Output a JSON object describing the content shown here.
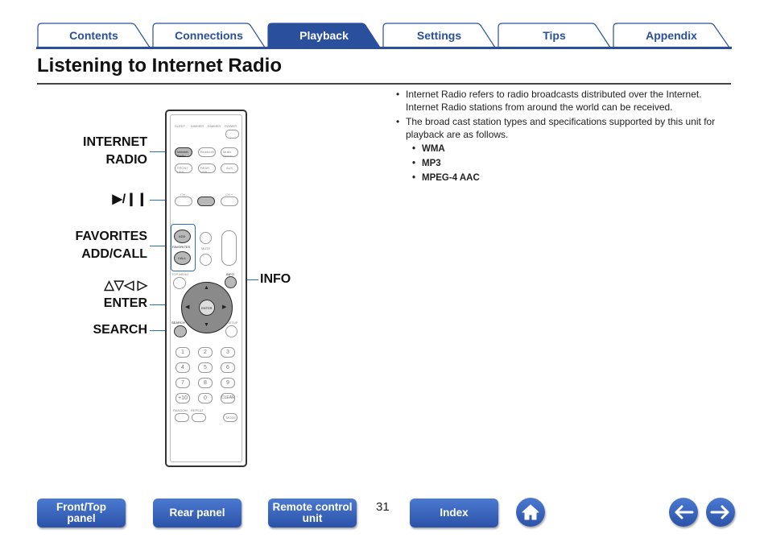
{
  "tabs": [
    {
      "label": "Contents"
    },
    {
      "label": "Connections"
    },
    {
      "label": "Playback"
    },
    {
      "label": "Settings"
    },
    {
      "label": "Tips"
    },
    {
      "label": "Appendix"
    }
  ],
  "page_title": "Listening to Internet Radio",
  "bullets": [
    {
      "text": "Internet Radio refers to radio broadcasts distributed over the Internet. Internet Radio stations from around the world can be received."
    },
    {
      "text": "The broad cast station types and specifications supported by this unit for playback are as follows."
    }
  ],
  "formats": [
    "WMA",
    "MP3",
    "MPEG-4 AAC"
  ],
  "remote_labels": {
    "internet_radio": "INTERNET\nRADIO",
    "play_pause": "▶/❙❙",
    "favorites": "FAVORITES\nADD/CALL",
    "arrows": "△▽◁ ▷",
    "enter": "ENTER",
    "search": "SEARCH",
    "info": "INFO"
  },
  "remote": {
    "row1": [
      "SLEEP",
      "DIMMER",
      "DIMMER",
      "POWER"
    ],
    "inet_key": "Internet Radio",
    "bt_key": "Bluetooth",
    "music_key": "Music Server",
    "front_key": "FRONT USB",
    "rear_key": "REAR USB",
    "aux_key": "AUX",
    "ch_minus": "CH -",
    "ch_plus": "CH +",
    "add_key": "ADD",
    "call_key": "CALL",
    "favorites_tiny": "FAVORITES",
    "bass_key": "BASS TONE",
    "mute_key": "MUTE",
    "volume_key": "VOLUME",
    "top_menu": "TOP MENU",
    "info_tiny": "INFO",
    "enter_key": "ENTER",
    "search_tiny": "SEARCH",
    "setup_tiny": "SETUP",
    "numbers": [
      "1",
      "2",
      "3",
      "4",
      "5",
      "6",
      "7",
      "8",
      "9",
      "+10",
      "0",
      "CLEAR"
    ],
    "random": "RANDOM",
    "repeat": "REPEAT",
    "mode": "MODE"
  },
  "bottom_buttons": {
    "front_top": "Front/Top\npanel",
    "rear": "Rear panel",
    "remote": "Remote control\nunit",
    "index": "Index"
  },
  "page_number": "31",
  "icons": [
    "home-icon",
    "arrow-left-icon",
    "arrow-right-icon"
  ],
  "colors": {
    "accent": "#2a4f9c",
    "leader": "#2a6fbd"
  }
}
